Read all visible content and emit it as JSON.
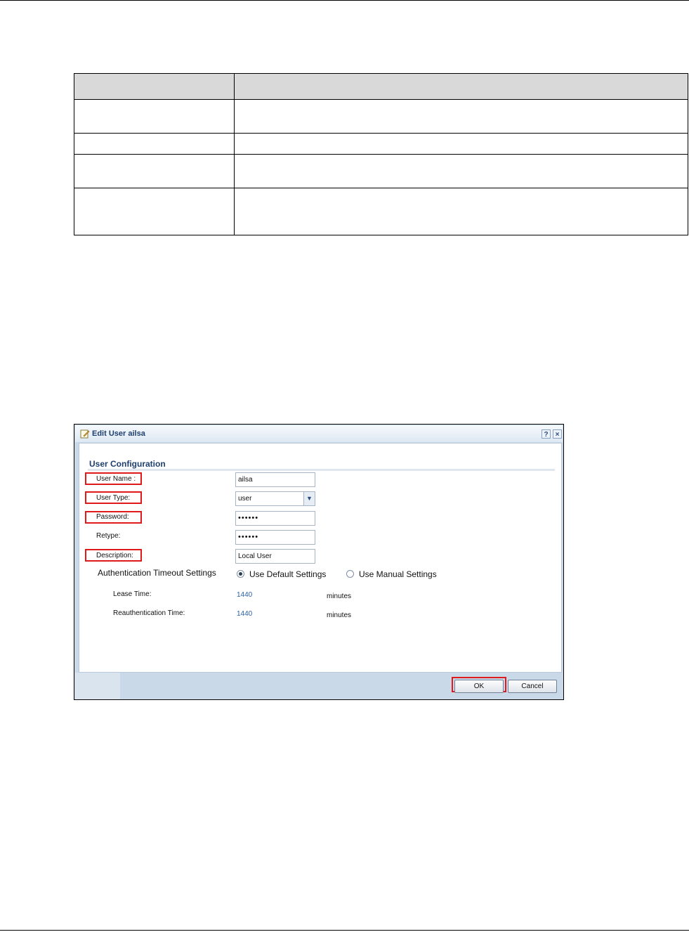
{
  "table": {
    "header": [
      "",
      ""
    ],
    "rows": [
      [
        "",
        ""
      ],
      [
        "",
        ""
      ],
      [
        "",
        ""
      ],
      [
        "",
        ""
      ]
    ]
  },
  "dialog": {
    "title": "Edit User ailsa",
    "help_label": "?",
    "close_label": "×",
    "section_title": "User Configuration",
    "fields": {
      "user_name_label": "User Name :",
      "user_name_value": "ailsa",
      "user_type_label": "User Type:",
      "user_type_value": "user",
      "password_label": "Password:",
      "password_value": "••••••",
      "retype_label": "Retype:",
      "retype_value": "••••••",
      "description_label": "Description:",
      "description_value": "Local User"
    },
    "auth_timeout": {
      "label": "Authentication Timeout Settings",
      "option_default": "Use Default Settings",
      "option_manual": "Use Manual Settings",
      "selected": "default",
      "lease_time_label": "Lease Time:",
      "lease_time_value": "1440",
      "lease_time_unit": "minutes",
      "reauth_time_label": "Reauthentication Time:",
      "reauth_time_value": "1440",
      "reauth_time_unit": "minutes"
    },
    "ok_label": "OK",
    "cancel_label": "Cancel"
  },
  "icons": {
    "title_icon": "edit-icon",
    "dropdown_icon": "chevron-down-icon"
  },
  "colors": {
    "highlight": "#e01a1a",
    "dialog_accent": "#1e3f6e",
    "value_blue": "#2a5fa8"
  }
}
